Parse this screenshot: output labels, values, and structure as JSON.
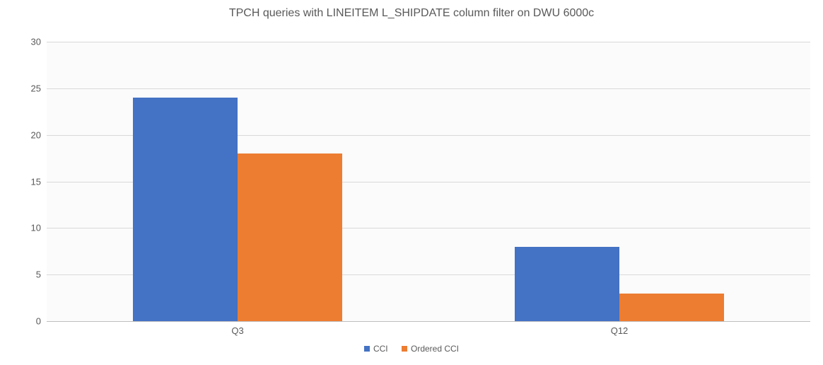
{
  "chart_data": {
    "type": "bar",
    "title": "TPCH queries with LINEITEM L_SHIPDATE column filter on DWU 6000c",
    "xlabel": "",
    "ylabel": "",
    "ylim": [
      0,
      30
    ],
    "yticks": [
      0,
      5,
      10,
      15,
      20,
      25,
      30
    ],
    "categories": [
      "Q3",
      "Q12"
    ],
    "series": [
      {
        "name": "CCI",
        "color": "#4472C4",
        "values": [
          24,
          8
        ]
      },
      {
        "name": "Ordered CCI",
        "color": "#ED7D31",
        "values": [
          18,
          3
        ]
      }
    ],
    "legend_position": "bottom",
    "grid": true
  }
}
